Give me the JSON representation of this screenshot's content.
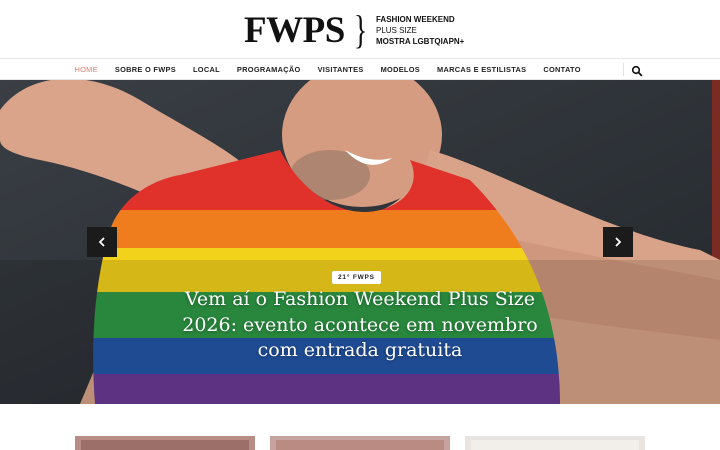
{
  "logo": {
    "mark": "FWPS",
    "brace": "}",
    "line1": "FASHION WEEKEND",
    "line2": "PLUS SIZE",
    "line3": "MOSTRA LGBTQIAPN+"
  },
  "nav": {
    "items": [
      {
        "label": "HOME",
        "active": true
      },
      {
        "label": "SOBRE O FWPS"
      },
      {
        "label": "LOCAL"
      },
      {
        "label": "PROGRAMAÇÃO"
      },
      {
        "label": "VISITANTES"
      },
      {
        "label": "MODELOS"
      },
      {
        "label": "MARCAS E ESTILISTAS"
      },
      {
        "label": "CONTATO"
      }
    ],
    "search_icon": "search-icon",
    "active_color": "#d9826c"
  },
  "hero": {
    "badge": "21° FWPS",
    "headline": "Vem aí o Fashion Weekend Plus Size 2026: evento acontece em novembro com entrada gratuita",
    "prev_icon": "chevron-left-icon",
    "next_icon": "chevron-right-icon",
    "rainbow_colors": [
      "#e0322b",
      "#ef7d1e",
      "#f3d21b",
      "#2e9a45",
      "#2456a8",
      "#6b3a95"
    ]
  }
}
